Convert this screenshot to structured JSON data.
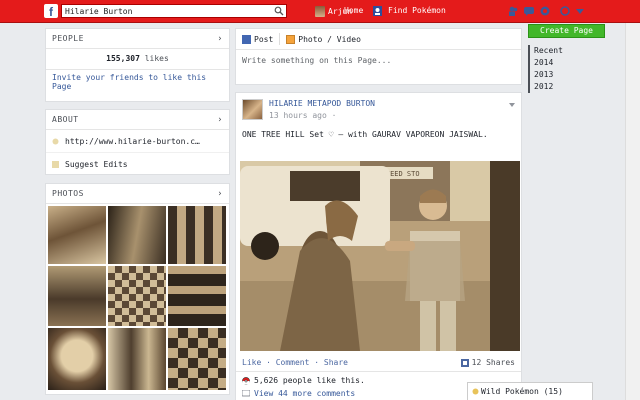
{
  "topbar": {
    "search_value": "Hilarie Burton",
    "profile_name": "Arjun",
    "home_label": "Home",
    "find_pokemon_label": "Find Pokémon"
  },
  "people": {
    "title": "PEOPLE",
    "likes_count": "155,307",
    "likes_word": "likes",
    "invite_text": "Invite your friends to like this Page"
  },
  "about": {
    "title": "ABOUT",
    "website": "http://www.hilarie-burton.c…",
    "suggest_edits": "Suggest Edits"
  },
  "photos": {
    "title": "PHOTOS"
  },
  "composer": {
    "tab_post": "Post",
    "tab_photo": "Photo / Video",
    "placeholder": "Write something on this Page..."
  },
  "post": {
    "author": "HILARIE METAPOD BURTON",
    "time": "13 hours ago",
    "text": "ONE TREE HILL Set ♡ — with GAURAV VAPOREON JAISWAL.",
    "sign_text": "OND FEED STO",
    "like": "Like",
    "comment": "Comment",
    "share": "Share",
    "shares_count": "12 Shares",
    "likes_text": "5,626 people like this.",
    "comments_text": "View 44 more comments"
  },
  "right": {
    "create_page": "Create Page",
    "years": [
      "Recent",
      "2014",
      "2013",
      "2012"
    ]
  },
  "wild_pokemon": "Wild Pokémon (15)",
  "colors": {
    "topbar": "#e41b1b",
    "link": "#365899",
    "create_page": "#42b72a"
  }
}
